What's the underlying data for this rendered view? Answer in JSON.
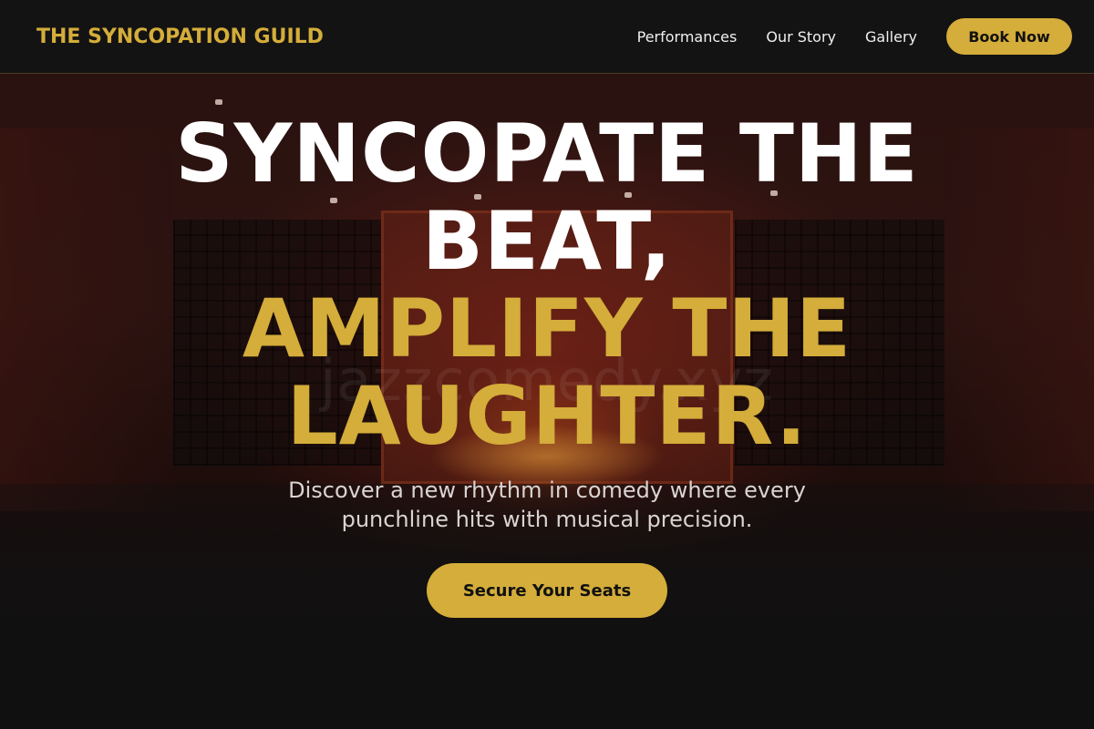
{
  "header": {
    "brand": "THE SYNCOPATION GUILD",
    "nav": [
      {
        "label": "Performances"
      },
      {
        "label": "Our Story"
      },
      {
        "label": "Gallery"
      }
    ],
    "cta_label": "Book Now"
  },
  "hero": {
    "headline_line1": "SYNCOPATE THE BEAT,",
    "headline_line2": "AMPLIFY THE LAUGHTER.",
    "subtitle": "Discover a new rhythm in comedy where every punchline hits with musical precision.",
    "cta_label": "Secure Your Seats",
    "watermark": "jazzcomedy.xyz"
  },
  "colors": {
    "accent": "#d4ad3a",
    "background": "#121111",
    "text": "#ffffff"
  }
}
